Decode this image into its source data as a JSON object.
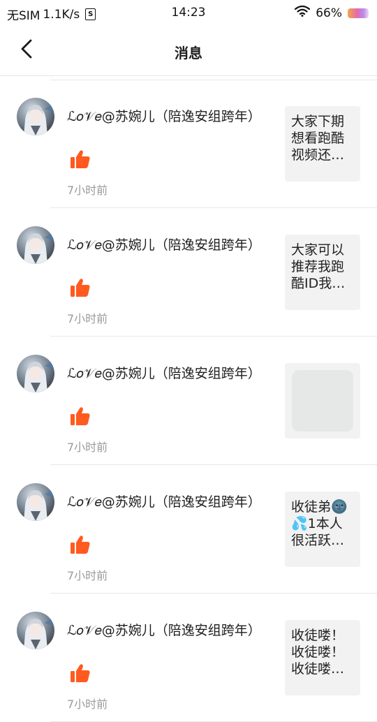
{
  "status_bar": {
    "carrier": "无SIM",
    "speed": "1.1K/s",
    "sim_badge": "S",
    "time": "14:23",
    "battery": "66%"
  },
  "nav": {
    "title": "消息",
    "back_icon": "chevron-left-icon"
  },
  "messages": [
    {
      "username": "ℒ𝑜𝒱𝑒@苏婉儿（陪逸安组跨年）",
      "action_icon": "thumbs-up-icon",
      "time": "7小时前",
      "preview_text": "大家下期想看跑酷视频还…",
      "preview_kind": "text"
    },
    {
      "username": "ℒ𝑜𝒱𝑒@苏婉儿（陪逸安组跨年）",
      "action_icon": "thumbs-up-icon",
      "time": "7小时前",
      "preview_text": "大家可以推荐我跑酷ID我…",
      "preview_kind": "text"
    },
    {
      "username": "ℒ𝑜𝒱𝑒@苏婉儿（陪逸安组跨年）",
      "action_icon": "thumbs-up-icon",
      "time": "7小时前",
      "preview_text": "",
      "preview_kind": "image"
    },
    {
      "username": "ℒ𝑜𝒱𝑒@苏婉儿（陪逸安组跨年）",
      "action_icon": "thumbs-up-icon",
      "time": "7小时前",
      "preview_text": "收徒弟🌚💦1本人很活跃…",
      "preview_kind": "text"
    },
    {
      "username": "ℒ𝑜𝒱𝑒@苏婉儿（陪逸安组跨年）",
      "action_icon": "thumbs-up-icon",
      "time": "7小时前",
      "preview_text": "收徒喽！收徒喽！收徒喽…",
      "preview_kind": "text"
    }
  ],
  "colors": {
    "like": "#ff5a1f",
    "muted_text": "#9a9a9a",
    "preview_bg": "#f2f2f2"
  }
}
